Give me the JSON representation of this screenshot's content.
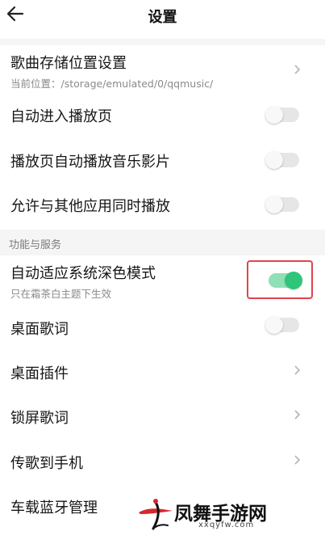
{
  "header": {
    "title": "设置",
    "back_icon": "arrow-left-icon"
  },
  "items": [
    {
      "label": "歌曲存储位置设置",
      "sub": "当前位置：/storage/emulated/0/qqmusic/",
      "control": "chevron"
    },
    {
      "label": "自动进入播放页",
      "control": "toggle",
      "on": false
    },
    {
      "label": "播放页自动播放音乐影片",
      "control": "toggle",
      "on": false
    },
    {
      "label": "允许与其他应用同时播放",
      "control": "toggle",
      "on": false
    }
  ],
  "section": {
    "label": "功能与服务",
    "items": [
      {
        "label": "自动适应系统深色模式",
        "sub": "只在霜茶白主题下生效",
        "control": "toggle",
        "on": true
      },
      {
        "label": "桌面歌词",
        "control": "toggle",
        "on": false
      },
      {
        "label": "桌面插件",
        "control": "chevron"
      },
      {
        "label": "锁屏歌词",
        "control": "chevron"
      },
      {
        "label": "传歌到手机",
        "control": "chevron"
      },
      {
        "label": "车载蓝牙管理"
      }
    ]
  },
  "watermark": {
    "text": "凤舞手游网",
    "url": "xxqyfw.com"
  },
  "colors": {
    "toggle_on_track": "#8fe0b4",
    "toggle_on_knob": "#2fc57a",
    "toggle_off_track": "#e6e6e6",
    "highlight": "#e0444e"
  }
}
